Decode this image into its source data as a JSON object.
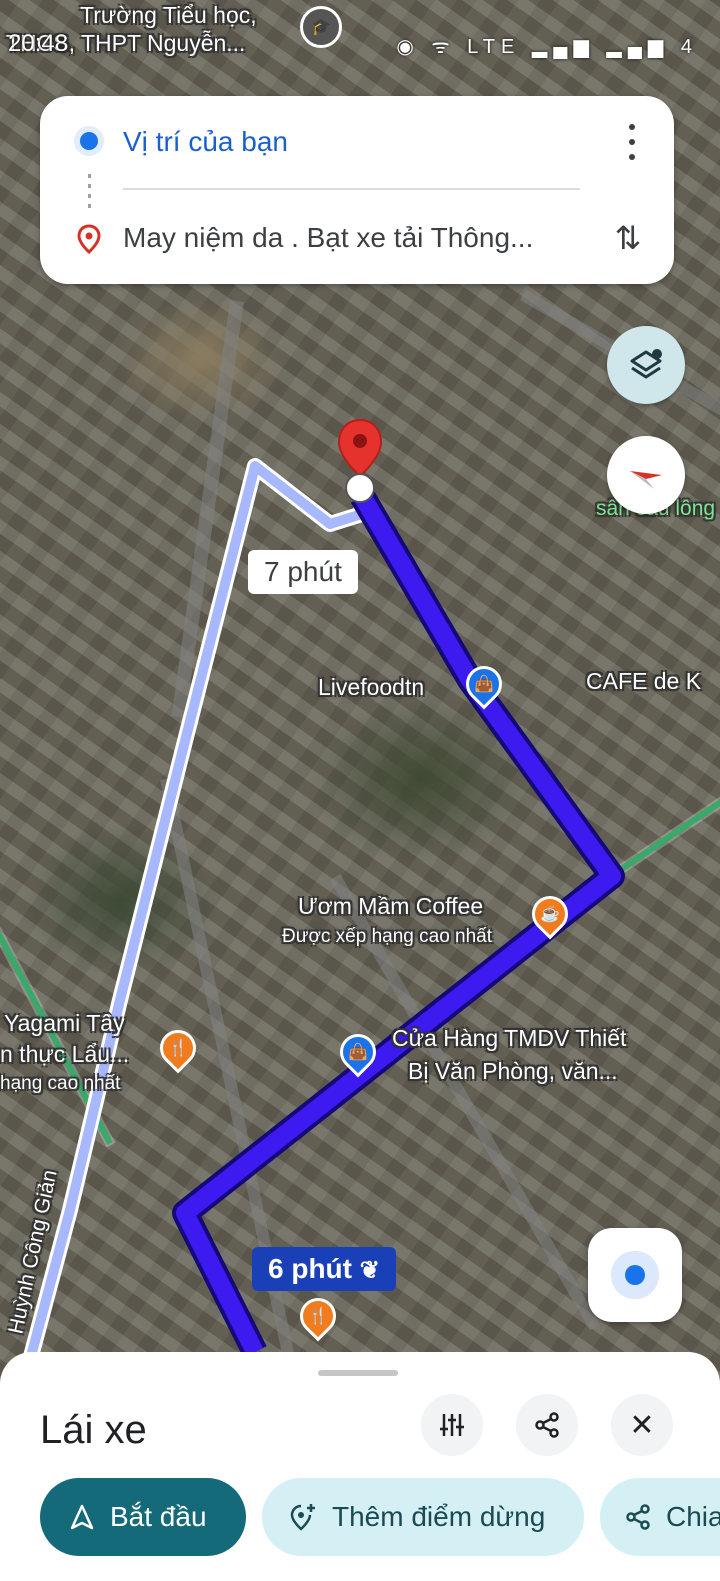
{
  "status_bar": {
    "time": "20:48",
    "icons_text": "◉ ᯤ LTE ▂▄▆ ▂▄▆ 4"
  },
  "map": {
    "top_label_line1": "Trường Tiểu học,",
    "top_label_line2": "THCS, THPT Nguyễn...",
    "right_edge_label": "sân cầu lông",
    "street_label": "Huỳnh Công Giản",
    "pois": [
      {
        "name": "Livefoodtn",
        "sub": "",
        "icon": "shopping-bag-icon",
        "color": "#1a73e8"
      },
      {
        "name": "CAFE de K",
        "sub": "",
        "icon": "none",
        "color": ""
      },
      {
        "name": "Ươm Mầm Coffee",
        "sub": "Được xếp hạng cao nhất",
        "icon": "coffee-icon",
        "color": "#f07c1e"
      },
      {
        "name": "Yagami Tây",
        "sub": "",
        "icon": "restaurant-icon",
        "color": "#f07c1e"
      },
      {
        "name": "n thực Lẩu...",
        "sub": "hạng cao nhất",
        "icon": "none",
        "color": ""
      },
      {
        "name": "Cửa Hàng TMDV Thiết",
        "sub": "Bị Văn Phòng, văn...",
        "icon": "shopping-bag-icon",
        "color": "#1a73e8"
      }
    ],
    "eta_alt": "7 phút",
    "eta_main": "6 phút"
  },
  "search_card": {
    "origin": "Vị trí của bạn",
    "destination": "May niệm da . Bạt xe tải Thông...",
    "more_icon": "more-vert-icon",
    "swap_icon": "swap-vert-icon"
  },
  "bottom_sheet": {
    "mode_title": "Lái xe",
    "start_label": "Bắt đầu",
    "add_stop_label": "Thêm điểm dừng",
    "share_label": "Chia sẻ"
  },
  "colors": {
    "route_main": "#3d1bf0",
    "route_alt": "#a8b8ff",
    "start_button": "#156a7a",
    "chip_bg": "#d4f0f4",
    "origin_text": "#1a5fd0"
  }
}
